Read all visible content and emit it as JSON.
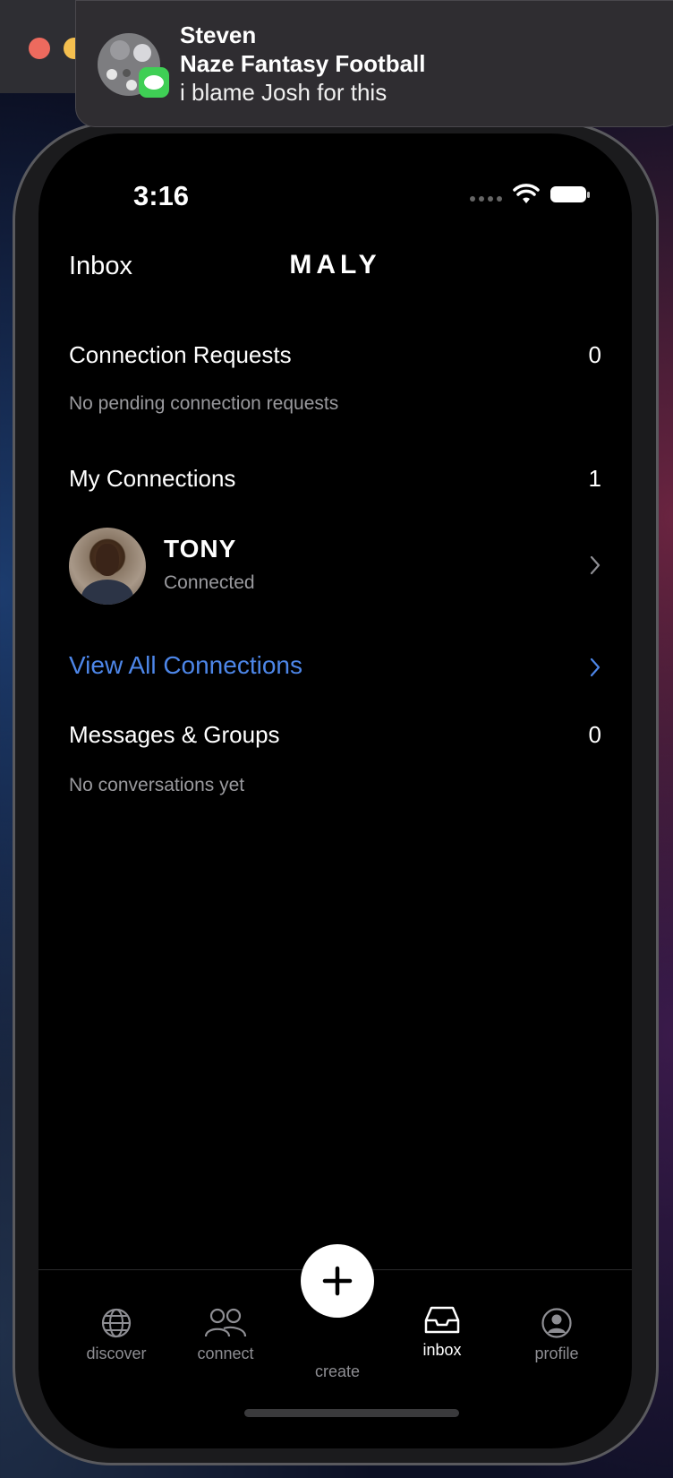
{
  "notification": {
    "sender": "Steven",
    "title": "Naze Fantasy Football",
    "body": "i blame Josh for this",
    "app_icon": "messages-icon"
  },
  "status_bar": {
    "time": "3:16"
  },
  "header": {
    "left_label": "Inbox",
    "app_name": "MALY"
  },
  "connection_requests": {
    "label": "Connection Requests",
    "count": "0",
    "empty_text": "No pending connection requests"
  },
  "my_connections": {
    "label": "My Connections",
    "count": "1",
    "items": [
      {
        "name": "TONY",
        "status": "Connected"
      }
    ],
    "view_all_label": "View All Connections"
  },
  "messages": {
    "label": "Messages & Groups",
    "count": "0",
    "empty_text": "No conversations yet"
  },
  "tab_bar": {
    "tabs": [
      {
        "label": "discover",
        "icon": "globe-icon"
      },
      {
        "label": "connect",
        "icon": "people-icon"
      },
      {
        "label": "create",
        "icon": "plus-icon"
      },
      {
        "label": "inbox",
        "icon": "inbox-icon"
      },
      {
        "label": "profile",
        "icon": "profile-icon"
      }
    ],
    "active": "inbox"
  },
  "colors": {
    "accent": "#4d86e8",
    "background": "#000000",
    "muted_text": "#9a9a9e"
  }
}
